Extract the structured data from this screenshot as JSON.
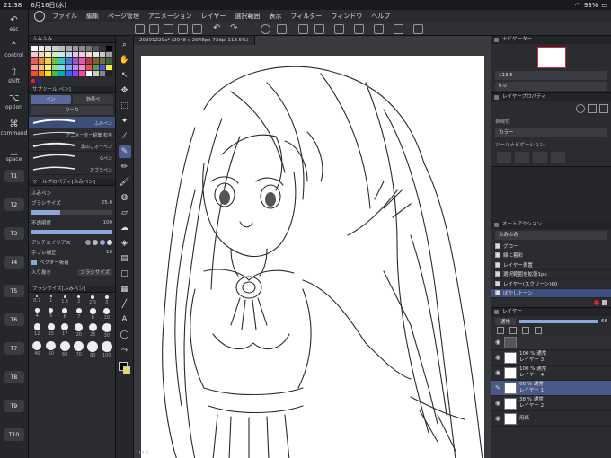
{
  "status": {
    "time": "21:38",
    "date": "6月16日(水)",
    "battery": "93%"
  },
  "menu": {
    "items": [
      "ファイル",
      "編集",
      "ページ管理",
      "アニメーション",
      "レイヤー",
      "選択範囲",
      "表示",
      "フィルター",
      "ウィンドウ",
      "ヘルプ"
    ]
  },
  "left_rail": {
    "keys": [
      {
        "label": "esc"
      },
      {
        "label": "control"
      },
      {
        "label": "shift"
      },
      {
        "label": "option"
      },
      {
        "label": "command"
      },
      {
        "label": "space"
      }
    ],
    "tbuttons": [
      "T1",
      "T2",
      "T3",
      "T4",
      "T5",
      "T6",
      "T7",
      "T8",
      "T9",
      "T10"
    ]
  },
  "color_panel": {
    "header": "ふみふみ"
  },
  "swatches": [
    "#ffffff",
    "#eeeeee",
    "#dddddd",
    "#cccccc",
    "#bbbbbb",
    "#aaaaaa",
    "#999999",
    "#888888",
    "#777777",
    "#555555",
    "#333333",
    "#000000",
    "#f6c9c9",
    "#f7d7b5",
    "#f9f0b8",
    "#d4f0bf",
    "#c2ecec",
    "#c3d3f4",
    "#e0c6f0",
    "#f6c6e2",
    "#ffd8d8",
    "#e8e8e8",
    "#c8c8c8",
    "#a0a0a0",
    "#e25c5c",
    "#f08a3c",
    "#f0d23c",
    "#6cc04a",
    "#3cc0c0",
    "#4a78d8",
    "#9a56c8",
    "#e25ca8",
    "#b34040",
    "#8a5a30",
    "#707030",
    "#406040",
    "#ff9a9a",
    "#ffc27a",
    "#fff07a",
    "#9ae07a",
    "#7ae0e0",
    "#7aa8ff",
    "#c28aff",
    "#ff8ad2",
    "#f05050",
    "#50a050",
    "#5050f0",
    "#f0f050",
    "#ff4444",
    "#ff8800",
    "#ffdd00",
    "#44bb44",
    "#00aaaa",
    "#3366ff",
    "#8844ff",
    "#ff44aa",
    "#ffffff",
    "#cccccc",
    "#888888",
    "#222222"
  ],
  "subtool": {
    "header": "サブツール[ペン]",
    "tabs": [
      "ペン",
      "効果ペ",
      "マーカ"
    ],
    "brushes": [
      {
        "label": "ふみペン"
      },
      {
        "label": "アニメーター鉛筆 松平"
      },
      {
        "label": "黒のこオーペン"
      },
      {
        "label": "Gペン"
      },
      {
        "label": "カブラペン"
      }
    ]
  },
  "tool_props": {
    "header": "ツールプロパティ[ふみペン]",
    "name": "ふみペン",
    "brush_size_label": "ブラシサイズ",
    "brush_size": "25.0",
    "opacity_label": "不透明度",
    "opacity": "100",
    "antialias_label": "アンチエイリアス",
    "stabilization_label": "手ブレ補正",
    "stabilization": "10",
    "vector_label": "ベクター吸着",
    "entry_label": "入り抜き",
    "entry_value": "ブラシサイズ"
  },
  "brush_size_palette": {
    "header": "ブラシサイズ[ふみペン]",
    "sizes": [
      "0.7",
      "1",
      "1.5",
      "2",
      "2.5",
      "3",
      "4",
      "5",
      "6",
      "7",
      "8",
      "10",
      "12",
      "15",
      "17",
      "20",
      "25",
      "30",
      "40",
      "50",
      "60",
      "70",
      "80",
      "100"
    ]
  },
  "canvas": {
    "tab": "20201220a* (2048 x 2048px 72dpi 113.5%)",
    "zoom": "113.5"
  },
  "navigator": {
    "header": "ナビゲーター",
    "zoom": "113.5",
    "angle": "0.0"
  },
  "layer_property": {
    "header": "レイヤープロパティ",
    "effect_label": "表現色",
    "color_value": "カラー",
    "tool_nav_label": "ツールナビゲーション"
  },
  "auto_action": {
    "header": "オートアクション",
    "set": "ふみふみ",
    "items": [
      {
        "label": "グロー",
        "selected": false
      },
      {
        "label": "線に着彩",
        "selected": false
      },
      {
        "label": "レイヤー表置",
        "selected": false
      },
      {
        "label": "選択範囲を拡張1px",
        "selected": false
      },
      {
        "label": "レイヤー(スクリーン)60",
        "selected": false
      },
      {
        "label": "ぼかしトーン",
        "selected": true
      }
    ]
  },
  "layers": {
    "header": "レイヤー",
    "blend": "通常",
    "opacity": "66",
    "items": [
      {
        "name": "",
        "meta": "",
        "type": "folder",
        "selected": false
      },
      {
        "name": "レイヤー 3",
        "meta": "100 % 通常",
        "type": "layer",
        "selected": false
      },
      {
        "name": "レイヤー 4",
        "meta": "100 % 通常",
        "type": "layer",
        "selected": false
      },
      {
        "name": "レイヤー 1",
        "meta": "66 % 通常",
        "type": "layer",
        "selected": true
      },
      {
        "name": "レイヤー 2",
        "meta": "38 % 通常",
        "type": "layer",
        "selected": false
      },
      {
        "name": "用紙",
        "meta": "",
        "type": "paper",
        "selected": false
      }
    ]
  }
}
